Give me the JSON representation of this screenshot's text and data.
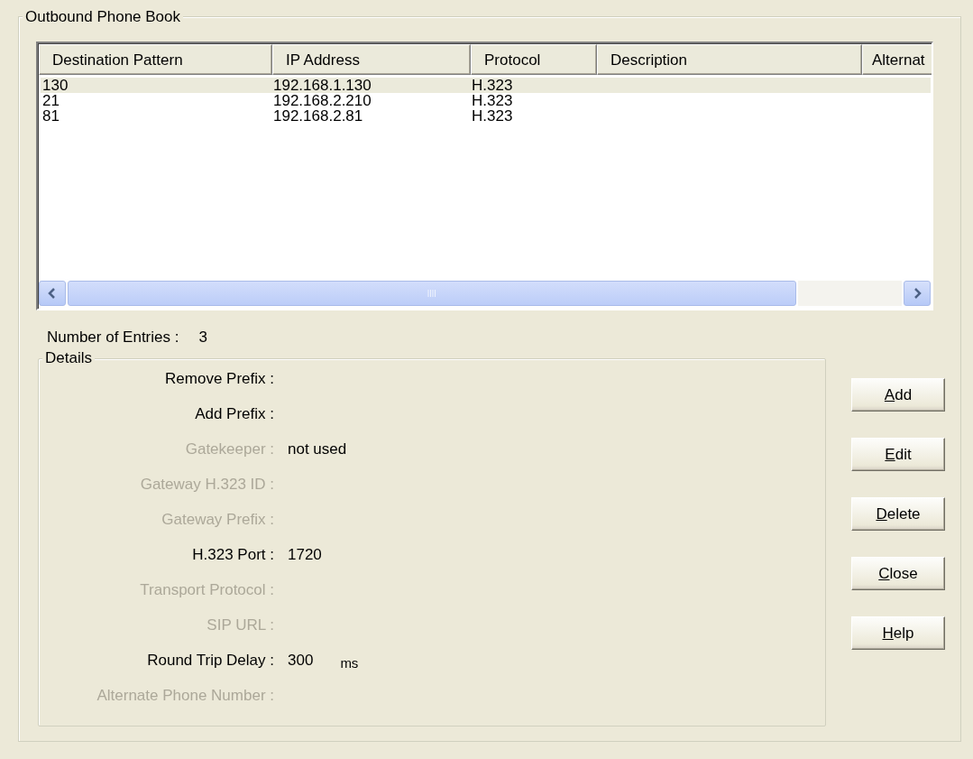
{
  "phone_book": {
    "title": "Outbound Phone Book",
    "table": {
      "columns": [
        "Destination Pattern",
        "IP Address",
        "Protocol",
        "Description",
        "Alternat"
      ],
      "rows": [
        {
          "cells": [
            "130",
            "192.168.1.130",
            "H.323"
          ],
          "selected": true
        },
        {
          "cells": [
            "21",
            "192.168.2.210",
            "H.323"
          ],
          "selected": false
        },
        {
          "cells": [
            "81",
            "192.168.2.81",
            "H.323"
          ],
          "selected": false
        }
      ]
    },
    "entries": {
      "label": "Number of Entries :",
      "value": "3"
    },
    "details": {
      "title": "Details",
      "fields": [
        {
          "label": "Remove Prefix :",
          "disabled": false
        },
        {
          "label": "Add Prefix :",
          "disabled": false
        },
        {
          "label": "Gatekeeper :",
          "value": "not used",
          "disabled": true
        },
        {
          "label": "Gateway H.323 ID :",
          "disabled": true
        },
        {
          "label": "Gateway Prefix :",
          "disabled": true
        },
        {
          "label": "H.323 Port :",
          "value": "1720",
          "disabled": false
        },
        {
          "label": "Transport Protocol :",
          "disabled": true
        },
        {
          "label": "SIP URL :",
          "disabled": true
        },
        {
          "label": "Round Trip Delay :",
          "value": "300",
          "unit": "ms",
          "disabled": false
        },
        {
          "label": "Alternate Phone Number :",
          "disabled": true
        }
      ]
    },
    "buttons": [
      "Add",
      "Edit",
      "Delete",
      "Close",
      "Help"
    ]
  }
}
